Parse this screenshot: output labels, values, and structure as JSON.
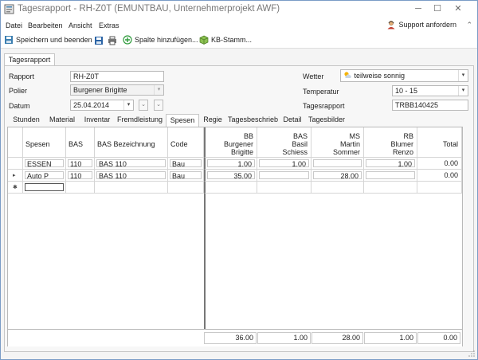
{
  "window": {
    "title": "Tagesrapport - RH-Z0T (EMUNTBAU, Unternehmerprojekt AWF)",
    "minimize": "─",
    "maximize": "☐",
    "close": "✕"
  },
  "menu": {
    "items": [
      "Datei",
      "Bearbeiten",
      "Ansicht",
      "Extras"
    ],
    "support_label": "Support anfordern",
    "collapse_glyph": "⌃"
  },
  "toolbar": {
    "save_close_label": "Speichern und beenden",
    "add_column_label": "Spalte hinzufügen...",
    "kb_stamm_label": "KB-Stamm..."
  },
  "top_tab": {
    "label": "Tagesrapport"
  },
  "form": {
    "rapport_label": "Rapport",
    "rapport_value": "RH-Z0T",
    "polier_label": "Polier",
    "polier_value": "Burgener Brigitte",
    "datum_label": "Datum",
    "datum_value": "25.04.2014",
    "wetter_label": "Wetter",
    "wetter_value": "teilweise sonnig",
    "temperatur_label": "Temperatur",
    "temperatur_value": "10 - 15",
    "tagesrapport_label": "Tagesrapport",
    "tagesrapport_value": "TRBB140425"
  },
  "subtabs": [
    "Stunden",
    "Material",
    "Inventar",
    "Fremdleistung",
    "Spesen",
    "Regie",
    "Tagesbeschrieb",
    "Detail",
    "Tagesbilder"
  ],
  "active_subtab": "Spesen",
  "grid": {
    "headers": {
      "spesen": "Spesen",
      "bas": "BAS",
      "bas_bez": "BAS Bezeichnung",
      "code": "Code",
      "bb": [
        "BB",
        "Burgener",
        "Brigitte"
      ],
      "bas2": [
        "BAS",
        "Basil",
        "Schiess"
      ],
      "ms": [
        "MS",
        "Martin",
        "Sommer"
      ],
      "rb": [
        "RB",
        "Blumer",
        "Renzo"
      ],
      "total": "Total"
    },
    "rows": [
      {
        "spesen": "ESSEN",
        "bas": "110",
        "bas_bez": "BAS 110",
        "code": "Bau",
        "bb": "1.00",
        "bas2": "1.00",
        "ms": "",
        "rb": "1.00",
        "total": "0.00"
      },
      {
        "spesen": "Auto P",
        "bas": "110",
        "bas_bez": "BAS 110",
        "code": "Bau",
        "bb": "35.00",
        "bas2": "",
        "ms": "28.00",
        "rb": "",
        "total": "0.00"
      }
    ],
    "row_indicators": [
      "",
      "▸",
      "✱"
    ],
    "totals": {
      "bb": "36.00",
      "bas2": "1.00",
      "ms": "28.00",
      "rb": "1.00",
      "total": "0.00"
    }
  },
  "colors": {
    "accent": "#3c7fb1",
    "border": "#b9b9b9"
  }
}
